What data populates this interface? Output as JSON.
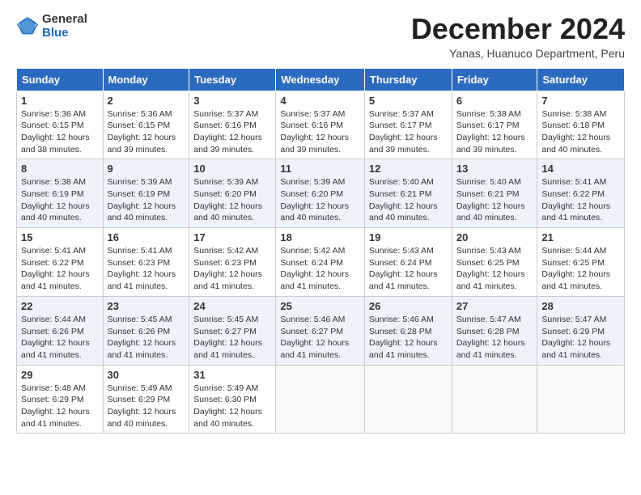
{
  "logo": {
    "general": "General",
    "blue": "Blue"
  },
  "header": {
    "month": "December 2024",
    "location": "Yanas, Huanuco Department, Peru"
  },
  "weekdays": [
    "Sunday",
    "Monday",
    "Tuesday",
    "Wednesday",
    "Thursday",
    "Friday",
    "Saturday"
  ],
  "weeks": [
    [
      {
        "day": "1",
        "sunrise": "5:36 AM",
        "sunset": "6:15 PM",
        "daylight": "12 hours and 38 minutes."
      },
      {
        "day": "2",
        "sunrise": "5:36 AM",
        "sunset": "6:15 PM",
        "daylight": "12 hours and 39 minutes."
      },
      {
        "day": "3",
        "sunrise": "5:37 AM",
        "sunset": "6:16 PM",
        "daylight": "12 hours and 39 minutes."
      },
      {
        "day": "4",
        "sunrise": "5:37 AM",
        "sunset": "6:16 PM",
        "daylight": "12 hours and 39 minutes."
      },
      {
        "day": "5",
        "sunrise": "5:37 AM",
        "sunset": "6:17 PM",
        "daylight": "12 hours and 39 minutes."
      },
      {
        "day": "6",
        "sunrise": "5:38 AM",
        "sunset": "6:17 PM",
        "daylight": "12 hours and 39 minutes."
      },
      {
        "day": "7",
        "sunrise": "5:38 AM",
        "sunset": "6:18 PM",
        "daylight": "12 hours and 40 minutes."
      }
    ],
    [
      {
        "day": "8",
        "sunrise": "5:38 AM",
        "sunset": "6:19 PM",
        "daylight": "12 hours and 40 minutes."
      },
      {
        "day": "9",
        "sunrise": "5:39 AM",
        "sunset": "6:19 PM",
        "daylight": "12 hours and 40 minutes."
      },
      {
        "day": "10",
        "sunrise": "5:39 AM",
        "sunset": "6:20 PM",
        "daylight": "12 hours and 40 minutes."
      },
      {
        "day": "11",
        "sunrise": "5:39 AM",
        "sunset": "6:20 PM",
        "daylight": "12 hours and 40 minutes."
      },
      {
        "day": "12",
        "sunrise": "5:40 AM",
        "sunset": "6:21 PM",
        "daylight": "12 hours and 40 minutes."
      },
      {
        "day": "13",
        "sunrise": "5:40 AM",
        "sunset": "6:21 PM",
        "daylight": "12 hours and 40 minutes."
      },
      {
        "day": "14",
        "sunrise": "5:41 AM",
        "sunset": "6:22 PM",
        "daylight": "12 hours and 41 minutes."
      }
    ],
    [
      {
        "day": "15",
        "sunrise": "5:41 AM",
        "sunset": "6:22 PM",
        "daylight": "12 hours and 41 minutes."
      },
      {
        "day": "16",
        "sunrise": "5:41 AM",
        "sunset": "6:23 PM",
        "daylight": "12 hours and 41 minutes."
      },
      {
        "day": "17",
        "sunrise": "5:42 AM",
        "sunset": "6:23 PM",
        "daylight": "12 hours and 41 minutes."
      },
      {
        "day": "18",
        "sunrise": "5:42 AM",
        "sunset": "6:24 PM",
        "daylight": "12 hours and 41 minutes."
      },
      {
        "day": "19",
        "sunrise": "5:43 AM",
        "sunset": "6:24 PM",
        "daylight": "12 hours and 41 minutes."
      },
      {
        "day": "20",
        "sunrise": "5:43 AM",
        "sunset": "6:25 PM",
        "daylight": "12 hours and 41 minutes."
      },
      {
        "day": "21",
        "sunrise": "5:44 AM",
        "sunset": "6:25 PM",
        "daylight": "12 hours and 41 minutes."
      }
    ],
    [
      {
        "day": "22",
        "sunrise": "5:44 AM",
        "sunset": "6:26 PM",
        "daylight": "12 hours and 41 minutes."
      },
      {
        "day": "23",
        "sunrise": "5:45 AM",
        "sunset": "6:26 PM",
        "daylight": "12 hours and 41 minutes."
      },
      {
        "day": "24",
        "sunrise": "5:45 AM",
        "sunset": "6:27 PM",
        "daylight": "12 hours and 41 minutes."
      },
      {
        "day": "25",
        "sunrise": "5:46 AM",
        "sunset": "6:27 PM",
        "daylight": "12 hours and 41 minutes."
      },
      {
        "day": "26",
        "sunrise": "5:46 AM",
        "sunset": "6:28 PM",
        "daylight": "12 hours and 41 minutes."
      },
      {
        "day": "27",
        "sunrise": "5:47 AM",
        "sunset": "6:28 PM",
        "daylight": "12 hours and 41 minutes."
      },
      {
        "day": "28",
        "sunrise": "5:47 AM",
        "sunset": "6:29 PM",
        "daylight": "12 hours and 41 minutes."
      }
    ],
    [
      {
        "day": "29",
        "sunrise": "5:48 AM",
        "sunset": "6:29 PM",
        "daylight": "12 hours and 41 minutes."
      },
      {
        "day": "30",
        "sunrise": "5:49 AM",
        "sunset": "6:29 PM",
        "daylight": "12 hours and 40 minutes."
      },
      {
        "day": "31",
        "sunrise": "5:49 AM",
        "sunset": "6:30 PM",
        "daylight": "12 hours and 40 minutes."
      },
      null,
      null,
      null,
      null
    ]
  ]
}
